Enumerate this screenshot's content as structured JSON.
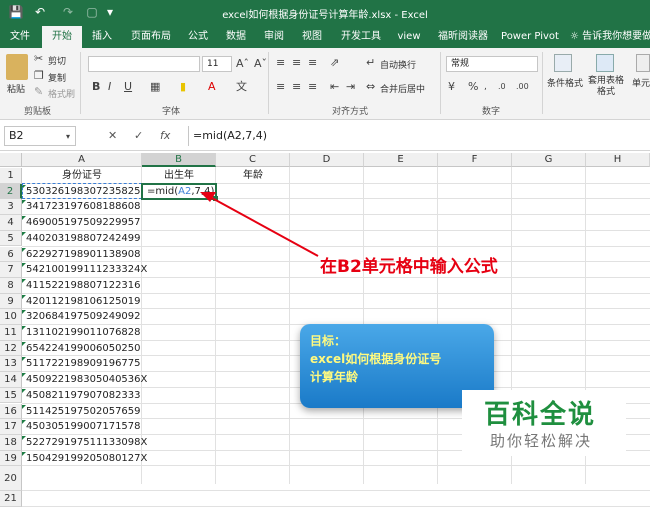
{
  "window": {
    "title": "excel如何根据身份证号计算年龄.xlsx - Excel"
  },
  "tabs": [
    "文件",
    "开始",
    "插入",
    "页面布局",
    "公式",
    "数据",
    "审阅",
    "视图",
    "开发工具",
    "view",
    "福昕阅读器",
    "Power Pivot"
  ],
  "active_tab": "开始",
  "tell_me": "告诉我你想要做",
  "ribbon": {
    "clipboard": {
      "paste": "粘贴",
      "cut": "剪切",
      "copy": "复制",
      "format_painter": "格式刷",
      "label": "剪贴板"
    },
    "font": {
      "size": "11",
      "bold": "B",
      "italic": "I",
      "underline": "U",
      "label": "字体"
    },
    "alignment": {
      "wrap": "自动换行",
      "merge": "合并后居中",
      "label": "对齐方式"
    },
    "number": {
      "format": "常规",
      "label": "数字"
    },
    "styles": {
      "conditional": "条件格式",
      "table_format": "套用表格格式",
      "cell_styles": "单元"
    }
  },
  "formula_bar": {
    "name_box": "B2",
    "cancel": "✕",
    "enter": "✓",
    "fx": "fx",
    "formula": "=mid(A2,7,4)"
  },
  "columns": [
    "A",
    "B",
    "C",
    "D",
    "E",
    "F",
    "G",
    "H"
  ],
  "rows": [
    "1",
    "2",
    "3",
    "4",
    "5",
    "6",
    "7",
    "8",
    "9",
    "10",
    "11",
    "12",
    "13",
    "14",
    "15",
    "16",
    "17",
    "18",
    "19",
    "20",
    "21"
  ],
  "headers": {
    "a1": "身份证号",
    "b1": "出生年",
    "c1": "年龄"
  },
  "ids": [
    "530326198307235825",
    "341723197608188608",
    "469005197509229957",
    "440203198807242499",
    "622927198901138908",
    "542100199111233324X",
    "411522198807122316",
    "420112198106125019",
    "320684197509249092",
    "131102199011076828",
    "654224199006050250",
    "511722198909196775",
    "450922198305040536X",
    "450821197907082333",
    "511425197502057659",
    "450305199007171578",
    "522729197511133098X",
    "150429199205080127X"
  ],
  "b2_formula": {
    "prefix": "=mid(",
    "ref": "A2",
    "suffix": ",7,4)"
  },
  "annotation": "在B2单元格中输入公式",
  "callout": {
    "line1": "目标：",
    "line2": "excel如何根据身份证号",
    "line3": "计算年龄"
  },
  "watermark": {
    "title": "百科全说",
    "subtitle": "助你轻松解决"
  }
}
